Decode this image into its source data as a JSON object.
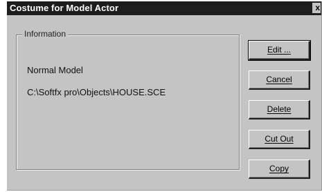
{
  "window": {
    "title": "Costume for Model Actor",
    "close_glyph": "x"
  },
  "information": {
    "legend": "Information",
    "model_type": "Normal Model",
    "file_path": "C:\\Softfx pro\\Objects\\HOUSE.SCE"
  },
  "buttons": {
    "edit": "Edit ...",
    "cancel": "Cancel",
    "delete": "Delete",
    "cut_out": "Cut Out",
    "copy": "Copy"
  }
}
